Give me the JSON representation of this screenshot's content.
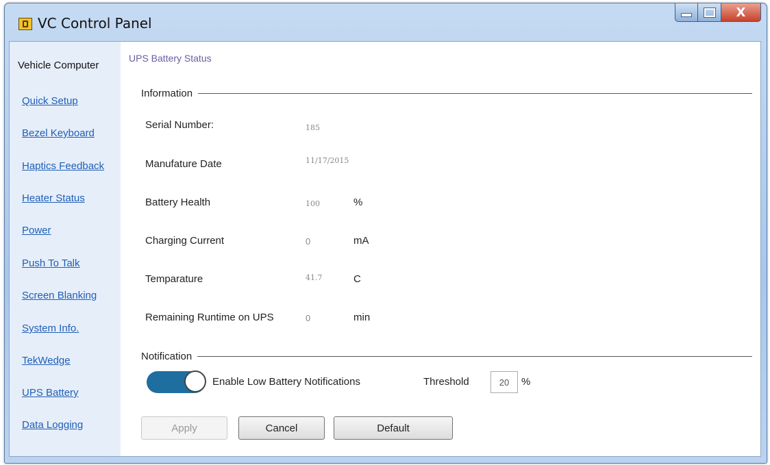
{
  "window": {
    "title": "VC Control Panel",
    "controls": {
      "minimize": "minimize",
      "maximize": "maximize",
      "close": "X"
    }
  },
  "sidebar": {
    "heading": "Vehicle Computer",
    "items": [
      {
        "label": "Quick Setup"
      },
      {
        "label": "Bezel Keyboard"
      },
      {
        "label": "Haptics Feedback"
      },
      {
        "label": "Heater Status"
      },
      {
        "label": "Power"
      },
      {
        "label": "Push To Talk"
      },
      {
        "label": "Screen Blanking"
      },
      {
        "label": "System Info."
      },
      {
        "label": "TekWedge"
      },
      {
        "label": "UPS Battery"
      },
      {
        "label": "Data Logging"
      }
    ]
  },
  "main": {
    "title": "UPS Battery Status",
    "information": {
      "heading": "Information",
      "fields": [
        {
          "label": "Serial Number:",
          "value": "185",
          "unit": ""
        },
        {
          "label": "Manufature Date",
          "value": "11/17/2015",
          "unit": ""
        },
        {
          "label": "Battery Health",
          "value": "100",
          "unit": "%"
        },
        {
          "label": "Charging Current",
          "value": "0",
          "unit": "mA"
        },
        {
          "label": "Temparature",
          "value": "41.7",
          "unit": "C"
        },
        {
          "label": "Remaining Runtime on UPS",
          "value": "0",
          "unit": "min"
        }
      ]
    },
    "notification": {
      "heading": "Notification",
      "toggle_on": true,
      "enable_label": "Enable Low Battery Notifications",
      "threshold_label": "Threshold",
      "threshold_value": "20",
      "threshold_unit": "%"
    },
    "buttons": {
      "apply": "Apply",
      "cancel": "Cancel",
      "default": "Default"
    }
  },
  "colors": {
    "accent": "#1e6ea0",
    "link": "#1f5fb5",
    "title_purple": "#6a5ca0",
    "close_red": "#c8412c"
  }
}
